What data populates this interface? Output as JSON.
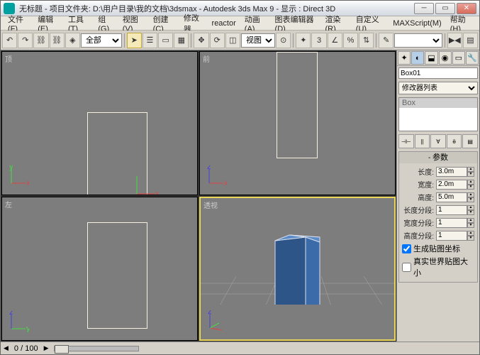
{
  "window": {
    "title": "无标题    - 项目文件夹: D:\\用户目录\\我的文档\\3dsmax    - Autodesk 3ds Max 9    - 显示 : Direct 3D"
  },
  "menu": {
    "file": "文件(F)",
    "edit": "编辑(E)",
    "tools": "工具(T)",
    "group": "组(G)",
    "view": "视图(V)",
    "create": "创建(C)",
    "modifiers": "修改器",
    "reactor": "reactor",
    "animation": "动画(A)",
    "grapheditor": "图表编辑器(D)",
    "rendering": "渲染(R)",
    "customize": "自定义(U)",
    "maxscript": "MAXScript(M)",
    "help": "帮助(H)"
  },
  "toolbar": {
    "selection_set": "全部",
    "view_dd": "视图"
  },
  "viewports": {
    "top": "顶",
    "front": "前",
    "left": "左",
    "perspective": "透视"
  },
  "panel": {
    "object_name": "Box01",
    "modifier_list": "修改器列表",
    "stack_item": "Box",
    "rollout_params": "参数",
    "length_label": "长度:",
    "length_val": "3.0m",
    "width_label": "宽度:",
    "width_val": "2.0m",
    "height_label": "高度:",
    "height_val": "5.0m",
    "lseg_label": "长度分段:",
    "lseg_val": "1",
    "wseg_label": "宽度分段:",
    "wseg_val": "1",
    "hseg_label": "高度分段:",
    "hseg_val": "1",
    "genmap": "生成贴图坐标",
    "realworld": "真实世界贴图大小"
  },
  "status": {
    "frame": "0  /  100"
  },
  "colors": {
    "box": "#3b6ba8"
  }
}
